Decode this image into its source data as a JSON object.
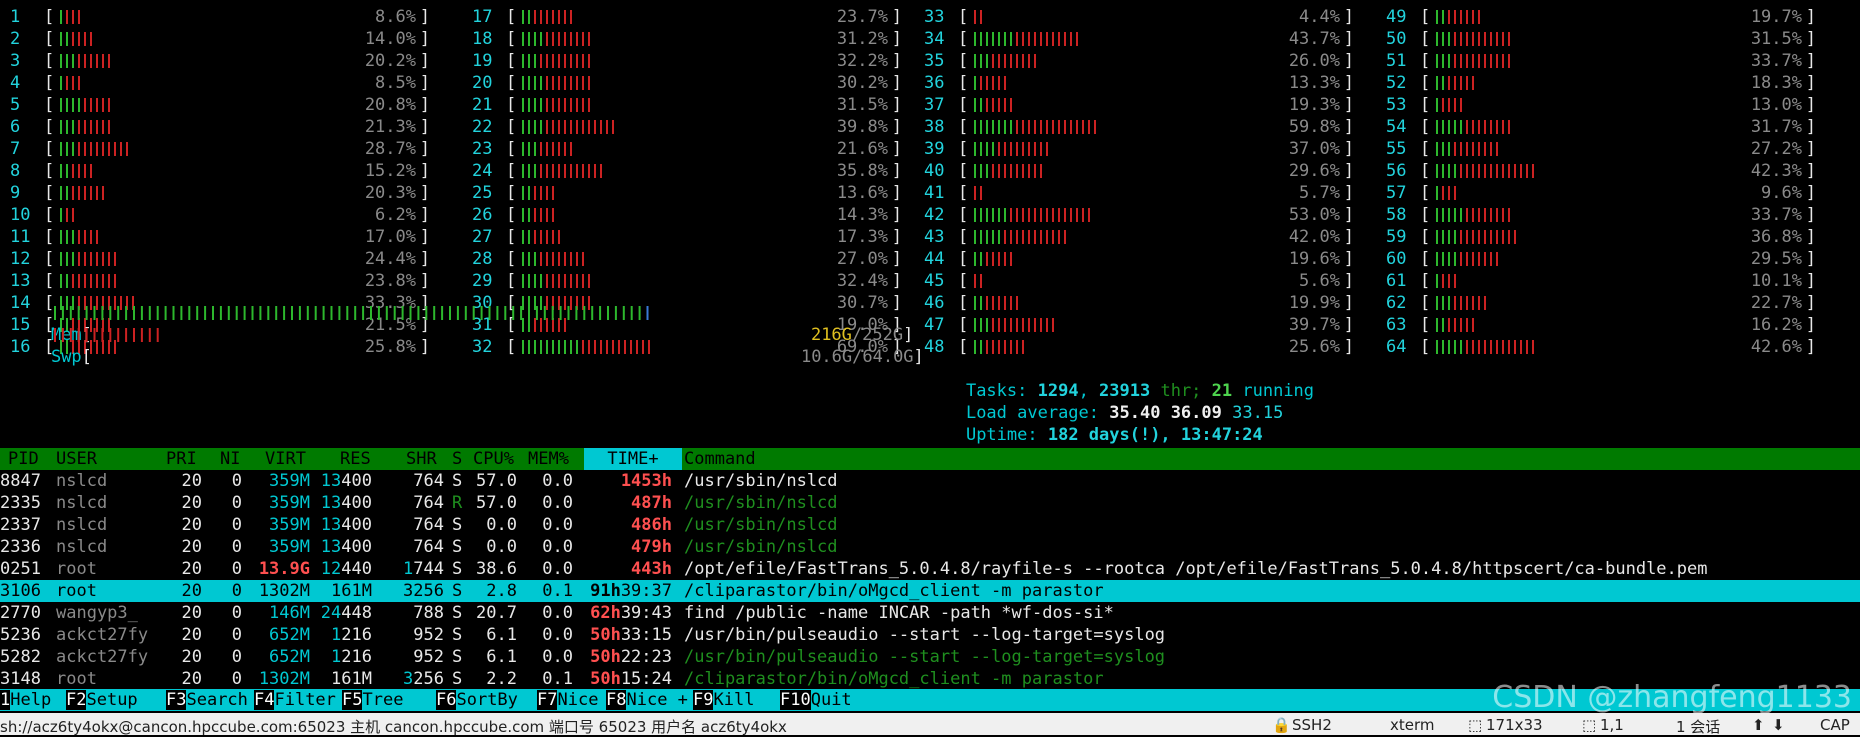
{
  "cpus": [
    {
      "n": "1",
      "pct": "8.6%",
      "g": 1,
      "r": 3
    },
    {
      "n": "2",
      "pct": "14.0%",
      "g": 2,
      "r": 4
    },
    {
      "n": "3",
      "pct": "20.2%",
      "g": 3,
      "r": 6
    },
    {
      "n": "4",
      "pct": "8.5%",
      "g": 1,
      "r": 3
    },
    {
      "n": "5",
      "pct": "20.8%",
      "g": 4,
      "r": 5
    },
    {
      "n": "6",
      "pct": "21.3%",
      "g": 3,
      "r": 6
    },
    {
      "n": "7",
      "pct": "28.7%",
      "g": 3,
      "r": 9
    },
    {
      "n": "8",
      "pct": "15.2%",
      "g": 2,
      "r": 4
    },
    {
      "n": "9",
      "pct": "20.3%",
      "g": 2,
      "r": 6
    },
    {
      "n": "10",
      "pct": "6.2%",
      "g": 1,
      "r": 2
    },
    {
      "n": "11",
      "pct": "17.0%",
      "g": 3,
      "r": 4
    },
    {
      "n": "12",
      "pct": "24.4%",
      "g": 3,
      "r": 7
    },
    {
      "n": "13",
      "pct": "23.8%",
      "g": 2,
      "r": 8
    },
    {
      "n": "14",
      "pct": "33.3%",
      "g": 3,
      "r": 10
    },
    {
      "n": "15",
      "pct": "21.5%",
      "g": 2,
      "r": 7
    },
    {
      "n": "16",
      "pct": "25.8%",
      "g": 2,
      "r": 8
    },
    {
      "n": "17",
      "pct": "23.7%",
      "g": 2,
      "r": 7
    },
    {
      "n": "18",
      "pct": "31.2%",
      "g": 4,
      "r": 8
    },
    {
      "n": "19",
      "pct": "32.2%",
      "g": 3,
      "r": 9
    },
    {
      "n": "20",
      "pct": "30.2%",
      "g": 4,
      "r": 8
    },
    {
      "n": "21",
      "pct": "31.5%",
      "g": 4,
      "r": 8
    },
    {
      "n": "22",
      "pct": "39.8%",
      "g": 4,
      "r": 12
    },
    {
      "n": "23",
      "pct": "21.6%",
      "g": 3,
      "r": 6
    },
    {
      "n": "24",
      "pct": "35.8%",
      "g": 3,
      "r": 11
    },
    {
      "n": "25",
      "pct": "13.6%",
      "g": 2,
      "r": 4
    },
    {
      "n": "26",
      "pct": "14.3%",
      "g": 2,
      "r": 4
    },
    {
      "n": "27",
      "pct": "17.3%",
      "g": 2,
      "r": 5
    },
    {
      "n": "28",
      "pct": "27.0%",
      "g": 3,
      "r": 8
    },
    {
      "n": "29",
      "pct": "32.4%",
      "g": 4,
      "r": 8
    },
    {
      "n": "30",
      "pct": "30.7%",
      "g": 4,
      "r": 8
    },
    {
      "n": "31",
      "pct": "19.0%",
      "g": 2,
      "r": 6
    },
    {
      "n": "32",
      "pct": "69.0%",
      "g": 10,
      "r": 12
    },
    {
      "n": "33",
      "pct": "4.4%",
      "g": 0,
      "r": 2
    },
    {
      "n": "34",
      "pct": "43.7%",
      "g": 7,
      "r": 11
    },
    {
      "n": "35",
      "pct": "26.0%",
      "g": 3,
      "r": 8
    },
    {
      "n": "36",
      "pct": "13.3%",
      "g": 1,
      "r": 5
    },
    {
      "n": "37",
      "pct": "19.3%",
      "g": 2,
      "r": 5
    },
    {
      "n": "38",
      "pct": "59.8%",
      "g": 7,
      "r": 14
    },
    {
      "n": "39",
      "pct": "37.0%",
      "g": 4,
      "r": 9
    },
    {
      "n": "40",
      "pct": "29.6%",
      "g": 3,
      "r": 9
    },
    {
      "n": "41",
      "pct": "5.7%",
      "g": 0,
      "r": 2
    },
    {
      "n": "42",
      "pct": "53.0%",
      "g": 6,
      "r": 14
    },
    {
      "n": "43",
      "pct": "42.0%",
      "g": 5,
      "r": 11
    },
    {
      "n": "44",
      "pct": "19.6%",
      "g": 2,
      "r": 5
    },
    {
      "n": "45",
      "pct": "5.6%",
      "g": 0,
      "r": 2
    },
    {
      "n": "46",
      "pct": "19.9%",
      "g": 2,
      "r": 6
    },
    {
      "n": "47",
      "pct": "39.7%",
      "g": 3,
      "r": 11
    },
    {
      "n": "48",
      "pct": "25.6%",
      "g": 2,
      "r": 7
    },
    {
      "n": "49",
      "pct": "19.7%",
      "g": 2,
      "r": 6
    },
    {
      "n": "50",
      "pct": "31.5%",
      "g": 3,
      "r": 10
    },
    {
      "n": "51",
      "pct": "33.7%",
      "g": 3,
      "r": 10
    },
    {
      "n": "52",
      "pct": "18.3%",
      "g": 2,
      "r": 5
    },
    {
      "n": "53",
      "pct": "13.0%",
      "g": 1,
      "r": 4
    },
    {
      "n": "54",
      "pct": "31.7%",
      "g": 5,
      "r": 8
    },
    {
      "n": "55",
      "pct": "27.2%",
      "g": 3,
      "r": 8
    },
    {
      "n": "56",
      "pct": "42.3%",
      "g": 4,
      "r": 13
    },
    {
      "n": "57",
      "pct": "9.6%",
      "g": 1,
      "r": 3
    },
    {
      "n": "58",
      "pct": "33.7%",
      "g": 5,
      "r": 8
    },
    {
      "n": "59",
      "pct": "36.8%",
      "g": 4,
      "r": 10
    },
    {
      "n": "60",
      "pct": "29.5%",
      "g": 4,
      "r": 7
    },
    {
      "n": "61",
      "pct": "10.1%",
      "g": 1,
      "r": 3
    },
    {
      "n": "62",
      "pct": "22.7%",
      "g": 3,
      "r": 6
    },
    {
      "n": "63",
      "pct": "16.2%",
      "g": 2,
      "r": 5
    },
    {
      "n": "64",
      "pct": "42.6%",
      "g": 5,
      "r": 12
    }
  ],
  "mem": {
    "label": "Mem",
    "used": "216G",
    "total": "/252G",
    "g": 76
  },
  "swp": {
    "label": "Swp",
    "value": "10.6G/64.0G",
    "r": 14
  },
  "tasks": {
    "label": "Tasks: ",
    "procs": "1294",
    "sep": ", ",
    "threads": "23913",
    "thr": " thr; ",
    "running": "21",
    "run": " running"
  },
  "load": {
    "label": "Load average: ",
    "one": "35.40",
    "five": "36.09",
    "fifteen": "33.15"
  },
  "uptime": {
    "label": "Uptime: ",
    "value": "182 days(!), 13:47:24"
  },
  "header": {
    "pid": "PID",
    "user": "USER",
    "pri": "PRI",
    "ni": "NI",
    "virt": "VIRT",
    "res": "RES",
    "shr": "SHR",
    "s": "S",
    "cpu": "CPU%",
    "mem": "MEM%",
    "time": "TIME+",
    "cmd": "Command"
  },
  "procs": [
    {
      "pid": "8847",
      "user": "nslcd",
      "pri": "20",
      "ni": "0",
      "virt": "359M",
      "res1": "13",
      "res2": "400",
      "shr1": "",
      "shr2": "764",
      "s": "S",
      "cpu": "57.0",
      "mem": "0.0",
      "th": "1453h",
      "tr": "",
      "cmd": "/usr/sbin/nslcd",
      "cmdc": "wht",
      "uc": "dim",
      "sc": "wht",
      "hl": false
    },
    {
      "pid": "2335",
      "user": "nslcd",
      "pri": "20",
      "ni": "0",
      "virt": "359M",
      "res1": "13",
      "res2": "400",
      "shr1": "",
      "shr2": "764",
      "s": "R",
      "cpu": "57.0",
      "mem": "0.0",
      "th": "487h",
      "tr": "",
      "cmd": "/usr/sbin/nslcd",
      "cmdc": "dgrn",
      "uc": "dim",
      "sc": "dgrn",
      "hl": false
    },
    {
      "pid": "2337",
      "user": "nslcd",
      "pri": "20",
      "ni": "0",
      "virt": "359M",
      "res1": "13",
      "res2": "400",
      "shr1": "",
      "shr2": "764",
      "s": "S",
      "cpu": "0.0",
      "mem": "0.0",
      "th": "486h",
      "tr": "",
      "cmd": "/usr/sbin/nslcd",
      "cmdc": "dgrn",
      "uc": "dim",
      "sc": "wht",
      "hl": false
    },
    {
      "pid": "2336",
      "user": "nslcd",
      "pri": "20",
      "ni": "0",
      "virt": "359M",
      "res1": "13",
      "res2": "400",
      "shr1": "",
      "shr2": "764",
      "s": "S",
      "cpu": "0.0",
      "mem": "0.0",
      "th": "479h",
      "tr": "",
      "cmd": "/usr/sbin/nslcd",
      "cmdc": "dgrn",
      "uc": "dim",
      "sc": "wht",
      "hl": false
    },
    {
      "pid": "0251",
      "user": "root",
      "pri": "20",
      "ni": "0",
      "virt": "13.9G",
      "res1": "12",
      "res2": "440",
      "shr1": "1",
      "shr2": "744",
      "s": "S",
      "cpu": "38.6",
      "mem": "0.0",
      "th": "443h",
      "tr": "",
      "cmd": "/opt/efile/FastTrans_5.0.4.8/rayfile-s --rootca /opt/efile/FastTrans_5.0.4.8/httpscert/ca-bundle.pem",
      "cmdc": "wht",
      "uc": "dim",
      "sc": "wht",
      "hl": false,
      "virtc": "bred"
    },
    {
      "pid": "3106",
      "user": "root",
      "pri": "20",
      "ni": "0",
      "virt": "1302M",
      "res1": "",
      "res2": "161M",
      "shr1": "",
      "shr2": "3256",
      "s": "S",
      "cpu": "2.8",
      "mem": "0.1",
      "th": "91h",
      "tr": "39:37",
      "cmd": "/cliparastor/bin/oMgcd_client -m parastor",
      "cmdc": "wht",
      "uc": "dim",
      "sc": "wht",
      "hl": true
    },
    {
      "pid": "2770",
      "user": "wangyp3_",
      "pri": "20",
      "ni": "0",
      "virt": "146M",
      "res1": "24",
      "res2": "448",
      "shr1": "",
      "shr2": "788",
      "s": "S",
      "cpu": "20.7",
      "mem": "0.0",
      "th": "62h",
      "tr": "39:43",
      "cmd": "find /public -name INCAR -path *wf-dos-si*",
      "cmdc": "wht",
      "uc": "dim",
      "sc": "wht",
      "hl": false
    },
    {
      "pid": "5236",
      "user": "ackct27fy",
      "pri": "20",
      "ni": "0",
      "virt": "652M",
      "res1": "1",
      "res2": "216",
      "shr1": "",
      "shr2": "952",
      "s": "S",
      "cpu": "6.1",
      "mem": "0.0",
      "th": "50h",
      "tr": "33:15",
      "cmd": "/usr/bin/pulseaudio --start --log-target=syslog",
      "cmdc": "wht",
      "uc": "dim",
      "sc": "wht",
      "hl": false
    },
    {
      "pid": "5282",
      "user": "ackct27fy",
      "pri": "20",
      "ni": "0",
      "virt": "652M",
      "res1": "1",
      "res2": "216",
      "shr1": "",
      "shr2": "952",
      "s": "S",
      "cpu": "6.1",
      "mem": "0.0",
      "th": "50h",
      "tr": "22:23",
      "cmd": "/usr/bin/pulseaudio --start --log-target=syslog",
      "cmdc": "dgrn",
      "uc": "dim",
      "sc": "wht",
      "hl": false
    },
    {
      "pid": "3148",
      "user": "root",
      "pri": "20",
      "ni": "0",
      "virt": "1302M",
      "res1": "",
      "res2": "161M",
      "shr1": "3",
      "shr2": "256",
      "s": "S",
      "cpu": "2.2",
      "mem": "0.1",
      "th": "50h",
      "tr": "15:24",
      "cmd": "/cliparastor/bin/oMgcd_client -m parastor",
      "cmdc": "dgrn",
      "uc": "dim",
      "sc": "wht",
      "hl": false
    }
  ],
  "fkeys": [
    {
      "k": "1",
      "l": "Help"
    },
    {
      "k": "F2",
      "l": "Setup"
    },
    {
      "k": "F3",
      "l": "Search"
    },
    {
      "k": "F4",
      "l": "Filter"
    },
    {
      "k": "F5",
      "l": "Tree"
    },
    {
      "k": "F6",
      "l": "SortBy"
    },
    {
      "k": "F7",
      "l": "Nice -"
    },
    {
      "k": "F8",
      "l": "Nice +"
    },
    {
      "k": "F9",
      "l": "Kill"
    },
    {
      "k": "F10",
      "l": "Quit"
    }
  ],
  "status": {
    "conn": "sh://acz6ty4okx@cancon.hpccube.com:65023 主机 cancon.hpccube.com 端口号 65023 用户名 acz6ty4okx",
    "proto": "SSH2",
    "term": "xterm",
    "size": "171x33",
    "pos": "1,1",
    "sessions": "1 会话",
    "caps": "CAP"
  },
  "watermark": "CSDN @zhangfeng1133"
}
